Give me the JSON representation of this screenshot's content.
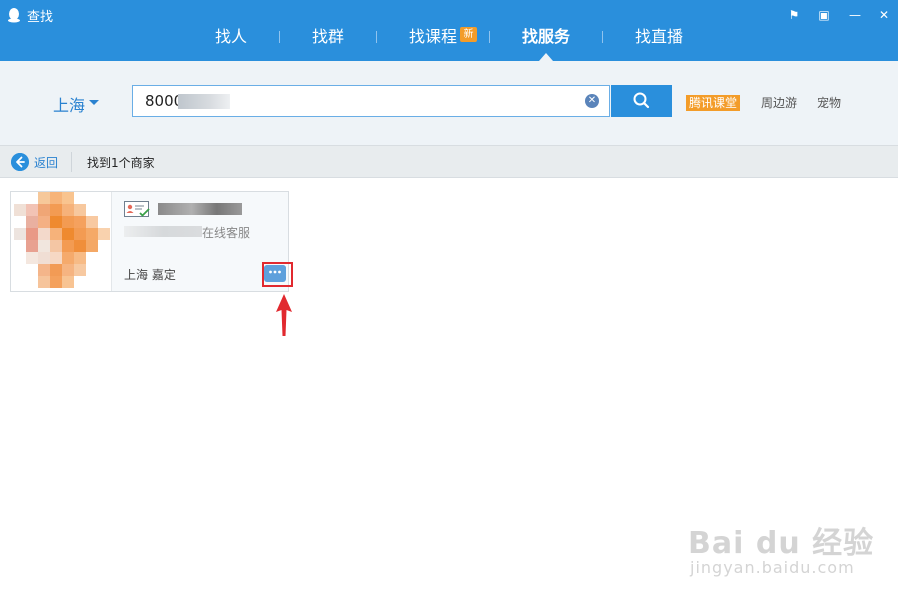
{
  "window": {
    "title": "查找"
  },
  "window_controls": {
    "feedback": "⚑",
    "pin": "▣",
    "minimize": "—",
    "close": "✕"
  },
  "tabs": [
    {
      "label": "找人"
    },
    {
      "label": "找群"
    },
    {
      "label": "找课程",
      "badge": "新"
    },
    {
      "label": "找服务",
      "active": true
    },
    {
      "label": "找直播"
    }
  ],
  "search": {
    "city": "上海",
    "query": "8000"
  },
  "quick_tags": {
    "hot": "腾讯课堂",
    "tag1": "周边游",
    "tag2": "宠物"
  },
  "result_bar": {
    "back_label": "返回",
    "count_text": "找到1个商家"
  },
  "results": [
    {
      "subtitle": "在线客服",
      "location": "上海 嘉定"
    }
  ],
  "watermark": {
    "main": "Bai du 经验",
    "sub": "jingyan.baidu.com"
  },
  "colors": {
    "brand_blue": "#2a8fdc",
    "badge_orange": "#f39c29",
    "annotation_red": "#e1292f"
  }
}
